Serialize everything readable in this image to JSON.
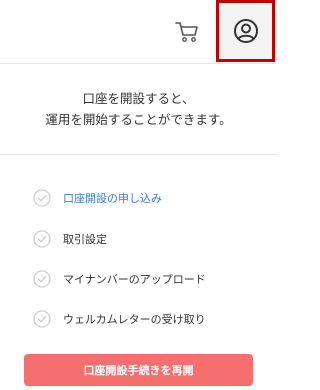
{
  "header": {
    "cart_icon": "shopping-cart-icon",
    "account_icon": "user-account-icon",
    "highlight_color": "#c40000"
  },
  "intro": {
    "line1": "口座を開設すると、",
    "line2": "運用を開始することができます。"
  },
  "steps": [
    {
      "label": "口座開設の申し込み",
      "state": "current"
    },
    {
      "label": "取引設定",
      "state": "pending"
    },
    {
      "label": "マイナンバーのアップロード",
      "state": "pending"
    },
    {
      "label": "ウェルカムレターの受け取り",
      "state": "pending"
    }
  ],
  "resume_button": {
    "label": "口座開設手続きを再開",
    "color": "#f56f6f"
  }
}
